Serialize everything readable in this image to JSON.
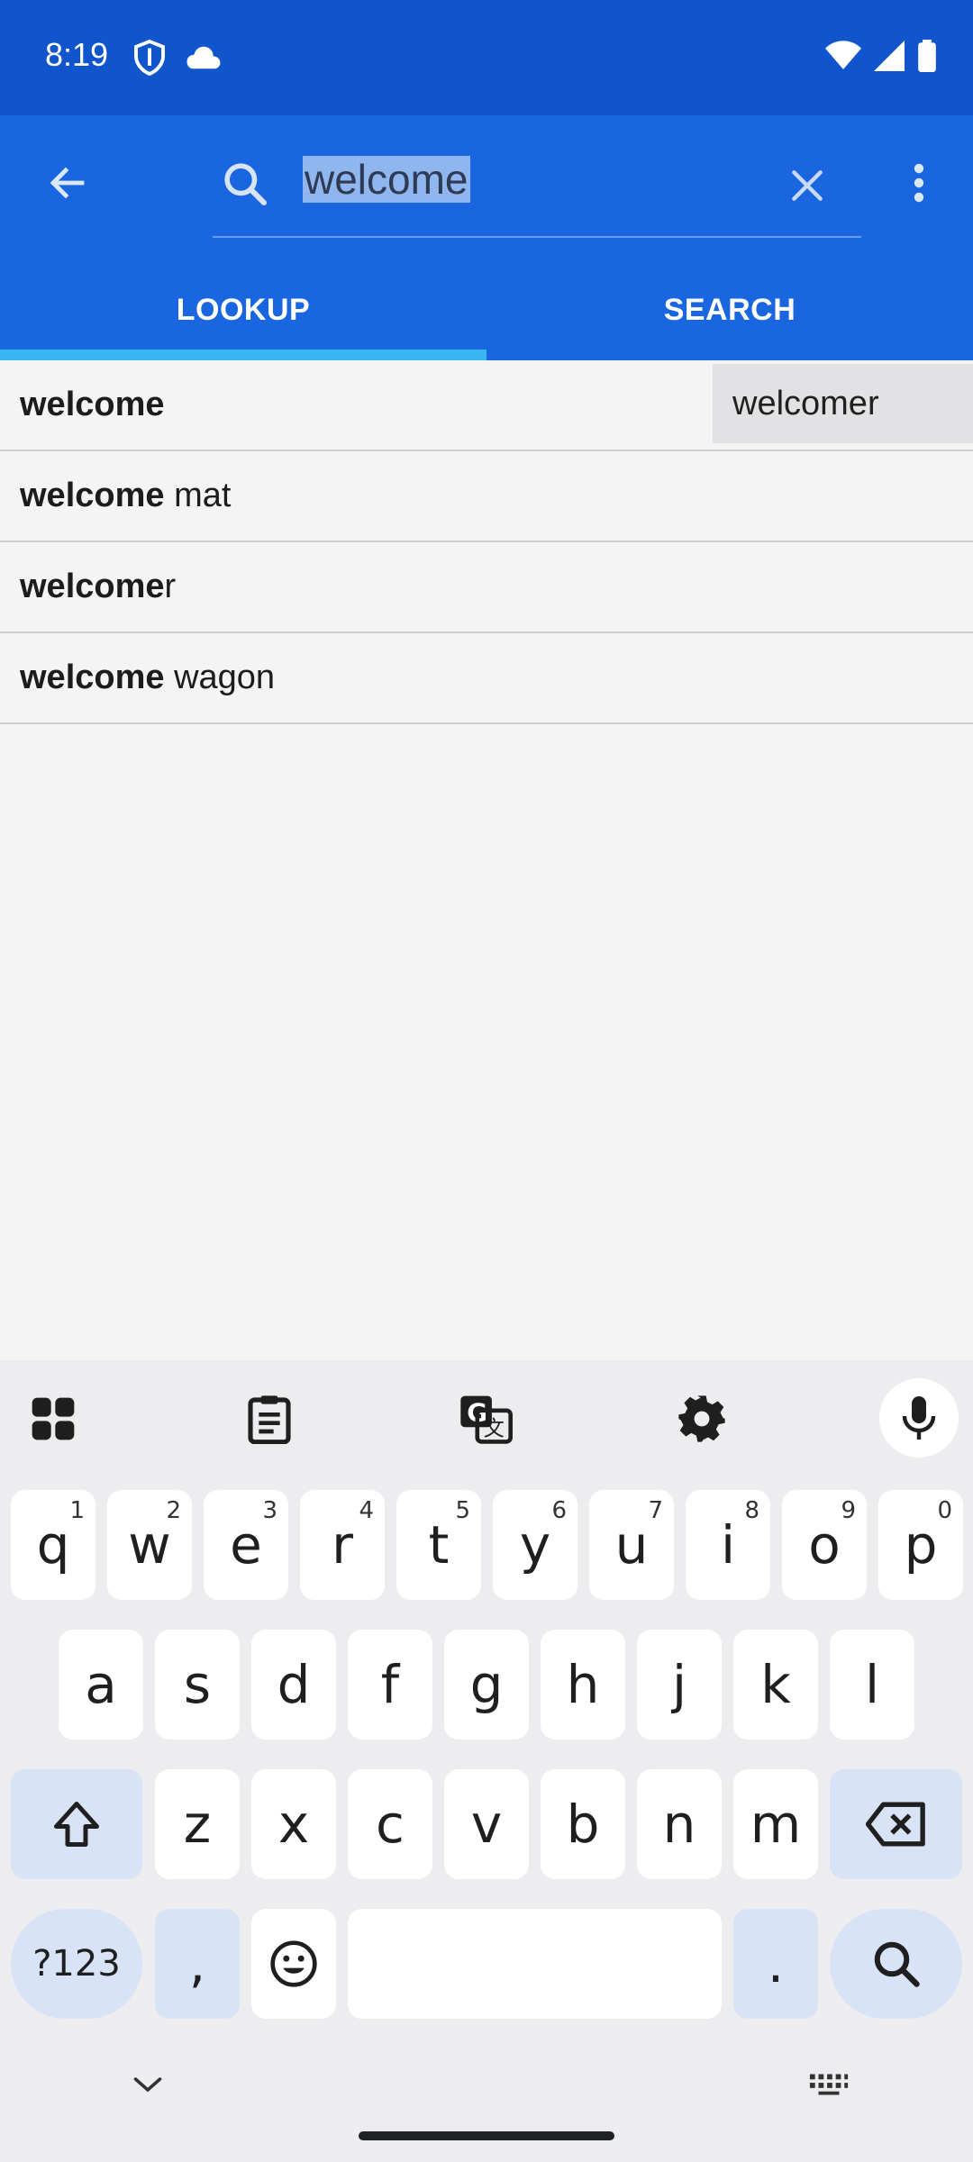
{
  "status_bar": {
    "time": "8:19",
    "icons": [
      "shield-icon",
      "cloud-icon",
      "wifi-icon",
      "signal-icon",
      "battery-icon"
    ]
  },
  "app_bar": {
    "search_value": "welcome",
    "tabs": [
      {
        "label": "LOOKUP",
        "active": true
      },
      {
        "label": "SEARCH",
        "active": false
      }
    ]
  },
  "results": [
    {
      "bold": "welcome",
      "rest": ""
    },
    {
      "bold": "welcome",
      "rest": " mat"
    },
    {
      "bold": "welcomer",
      "rest": ""
    },
    {
      "bold": "welcome",
      "rest": " wagon"
    }
  ],
  "autocomplete": "welcomer",
  "keyboard": {
    "row1": [
      {
        "k": "q",
        "h": "1"
      },
      {
        "k": "w",
        "h": "2"
      },
      {
        "k": "e",
        "h": "3"
      },
      {
        "k": "r",
        "h": "4"
      },
      {
        "k": "t",
        "h": "5"
      },
      {
        "k": "y",
        "h": "6"
      },
      {
        "k": "u",
        "h": "7"
      },
      {
        "k": "i",
        "h": "8"
      },
      {
        "k": "o",
        "h": "9"
      },
      {
        "k": "p",
        "h": "0"
      }
    ],
    "row2": [
      "a",
      "s",
      "d",
      "f",
      "g",
      "h",
      "j",
      "k",
      "l"
    ],
    "row3": [
      "z",
      "x",
      "c",
      "v",
      "b",
      "n",
      "m"
    ],
    "symbols_label": "?123",
    "comma": ",",
    "period": "."
  },
  "colors": {
    "status_bar": "#1155cc",
    "app_bar": "#1a66e0",
    "tab_indicator": "#38b6f0",
    "mod_key": "#d9e3f7"
  }
}
